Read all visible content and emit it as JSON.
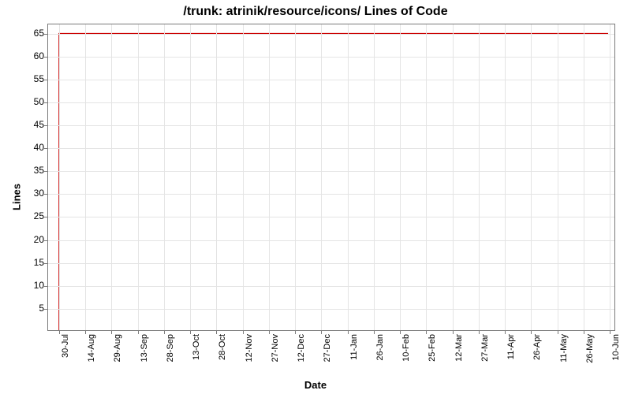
{
  "chart_data": {
    "type": "line",
    "title": "/trunk: atrinik/resource/icons/ Lines of Code",
    "xlabel": "Date",
    "ylabel": "Lines",
    "ylim": [
      0,
      67
    ],
    "yticks": [
      5,
      10,
      15,
      20,
      25,
      30,
      35,
      40,
      45,
      50,
      55,
      60,
      65
    ],
    "xticks": [
      "30-Jul",
      "14-Aug",
      "29-Aug",
      "13-Sep",
      "28-Sep",
      "13-Oct",
      "28-Oct",
      "12-Nov",
      "27-Nov",
      "12-Dec",
      "27-Dec",
      "11-Jan",
      "26-Jan",
      "10-Feb",
      "25-Feb",
      "12-Mar",
      "27-Mar",
      "11-Apr",
      "26-Apr",
      "11-May",
      "26-May",
      "10-Jun"
    ],
    "series": [
      {
        "name": "Lines of Code",
        "color": "#cc0000",
        "points": [
          {
            "x": "30-Jul",
            "y": 0
          },
          {
            "x": "30-Jul",
            "y": 65
          },
          {
            "x": "10-Jun",
            "y": 65
          }
        ]
      }
    ]
  }
}
